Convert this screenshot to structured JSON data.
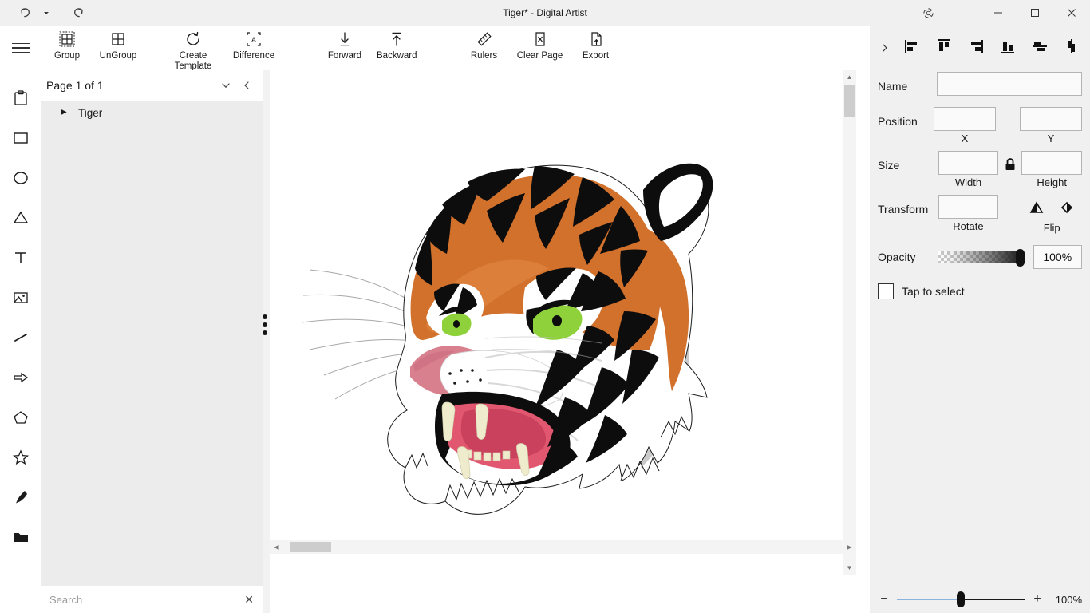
{
  "window": {
    "title": "Tiger*  -  Digital Artist",
    "undo_icon": "undo-icon",
    "undo_dropdown_icon": "chevron-down-icon",
    "redo_icon": "redo-icon",
    "settings_icon": "gear-icon",
    "minimize_icon": "minimize-icon",
    "maximize_icon": "maximize-icon",
    "close_icon": "close-icon"
  },
  "ribbon": {
    "menu_icon": "hamburger-icon",
    "items": [
      {
        "label": "Group",
        "icon": "group-icon"
      },
      {
        "label": "UnGroup",
        "icon": "ungroup-icon"
      },
      {
        "label": "Create\nTemplate",
        "icon": "create-template-icon"
      },
      {
        "label": "Difference",
        "icon": "difference-icon"
      },
      {
        "label": "Forward",
        "icon": "arrow-down-forward-icon"
      },
      {
        "label": "Backward",
        "icon": "arrow-up-backward-icon"
      },
      {
        "label": "Rulers",
        "icon": "ruler-icon"
      },
      {
        "label": "Clear Page",
        "icon": "clear-page-icon"
      },
      {
        "label": "Export",
        "icon": "export-icon"
      }
    ]
  },
  "toolrail": {
    "tools": [
      {
        "name": "clipboard-tool",
        "icon": "clipboard-icon"
      },
      {
        "name": "rectangle-tool",
        "icon": "rectangle-icon"
      },
      {
        "name": "ellipse-tool",
        "icon": "circle-icon"
      },
      {
        "name": "triangle-tool",
        "icon": "triangle-icon"
      },
      {
        "name": "text-tool",
        "icon": "text-icon"
      },
      {
        "name": "image-tool",
        "icon": "image-icon"
      },
      {
        "name": "line-tool",
        "icon": "line-icon"
      },
      {
        "name": "arrow-tool",
        "icon": "arrow-right-icon"
      },
      {
        "name": "pentagon-tool",
        "icon": "pentagon-icon"
      },
      {
        "name": "star-tool",
        "icon": "star-icon"
      },
      {
        "name": "pen-tool",
        "icon": "pen-icon"
      },
      {
        "name": "folder-tool",
        "icon": "folder-icon"
      }
    ]
  },
  "layers": {
    "page_label": "Page 1 of 1",
    "expand_icon": "chevron-down-icon",
    "collapse_icon": "chevron-left-icon",
    "items": [
      {
        "label": "Tiger",
        "expand_icon": "triangle-right-icon"
      }
    ],
    "search": {
      "placeholder": "Search",
      "value": "",
      "clear_icon": "close-icon"
    }
  },
  "canvas": {
    "splitter_icon": "drag-handle-dots-icon",
    "scroll_up_icon": "chevron-up-icon",
    "scroll_down_icon": "chevron-down-icon",
    "scroll_left_icon": "chevron-left-icon",
    "scroll_right_icon": "chevron-right-icon",
    "artwork_name": "tiger-artwork",
    "colors": {
      "orange": "#d2712c",
      "orange_dark": "#b85c22",
      "black": "#0d0d0d",
      "white": "#ffffff",
      "eye_green": "#8ed13a",
      "mouth_pink": "#e0576f",
      "mouth_pink_dark": "#c9415c",
      "nose_pink": "#d9808f",
      "fang_cream": "#eeeccd",
      "shadow_gray": "#c9c9c9"
    }
  },
  "properties": {
    "align_chevron_icon": "chevron-right-icon",
    "align_buttons": [
      {
        "name": "align-left-button",
        "icon": "align-left-icon"
      },
      {
        "name": "align-top-button",
        "icon": "align-top-icon"
      },
      {
        "name": "align-right-button",
        "icon": "align-right-icon"
      },
      {
        "name": "align-bottom-button",
        "icon": "align-bottom-icon"
      },
      {
        "name": "align-center-horizontal-button",
        "icon": "align-center-horizontal-icon"
      },
      {
        "name": "align-center-vertical-button",
        "icon": "align-center-vertical-icon"
      }
    ],
    "name": {
      "label": "Name",
      "value": ""
    },
    "position": {
      "label": "Position",
      "x_value": "",
      "x_sub": "X",
      "y_value": "",
      "y_sub": "Y"
    },
    "size": {
      "label": "Size",
      "width_value": "",
      "width_sub": "Width",
      "height_value": "",
      "height_sub": "Height",
      "lock_icon": "lock-icon"
    },
    "transform": {
      "label": "Transform",
      "rotate_value": "",
      "rotate_sub": "Rotate",
      "flip_sub": "Flip",
      "flip_vertical_icon": "flip-vertical-icon",
      "flip_horizontal_icon": "flip-horizontal-icon"
    },
    "opacity": {
      "label": "Opacity",
      "value": "100%",
      "percent": 100
    },
    "tap_to_select": {
      "label": "Tap to select",
      "checked": false
    }
  },
  "zoom": {
    "minus_label": "−",
    "plus_label": "+",
    "value": "100%",
    "percent": 100
  }
}
